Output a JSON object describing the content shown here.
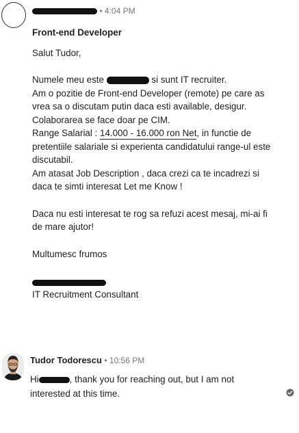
{
  "message1": {
    "time": "4:04 PM",
    "title": "Front-end Developer",
    "greeting": "Salut Tudor,",
    "intro_prefix": "Numele meu este",
    "intro_suffix": "si sunt IT recruiter.",
    "line2": "Am o pozitie de Front-end Developer (remote) pe care as vrea sa o discutam putin daca esti available, desigur.",
    "line3": "Colaborarea se face doar pe CIM.",
    "salary_prefix": "Range Salarial : ",
    "salary_value": "14.000 - 16.000 ron Net",
    "salary_suffix": ", in functie de pretentiile salariale si experienta candidatului range-ul este discutabil.",
    "line5": "Am atasat Job Description , daca crezi ca te incadrezi si daca te simti interesat Let me Know !",
    "line6": "Daca nu esti interesat te rog sa refuzi acest mesaj, mi-ai fi de mare ajutor!",
    "thanks": "Multumesc frumos",
    "signature_role": "IT Recruitment Consultant"
  },
  "message2": {
    "sender": "Tudor Todorescu",
    "time": "10:56 PM",
    "text_prefix": "Hi",
    "text_suffix": ", thank you for reaching out, but I am not interested at this time."
  },
  "icons": {
    "seen": "check-circle-icon",
    "avatar": "person-avatar-icon"
  },
  "colors": {
    "text": "#202020",
    "meta": "#777777",
    "redaction": "#111111"
  }
}
